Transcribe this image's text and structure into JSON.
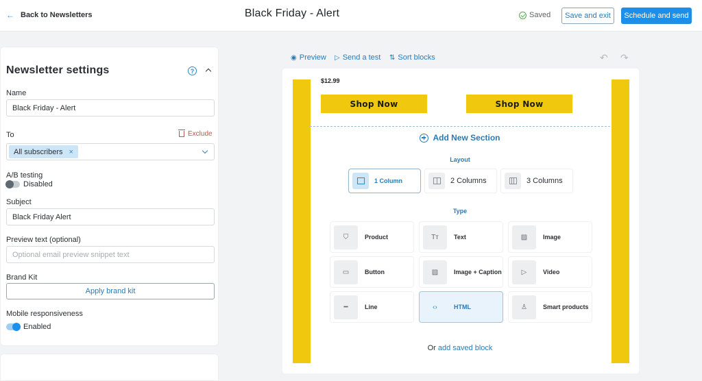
{
  "header": {
    "back_label": "Back to Newsletters",
    "title": "Black Friday - Alert",
    "saved_status": "Saved",
    "save_exit_label": "Save and exit",
    "schedule_label": "Schedule and send"
  },
  "settings": {
    "title": "Newsletter settings",
    "name": {
      "label": "Name",
      "value": "Black Friday - Alert"
    },
    "to": {
      "label": "To",
      "exclude_label": "Exclude",
      "chip": "All subscribers",
      "chip_remove": "×"
    },
    "ab_testing": {
      "label": "A/B testing",
      "state_label": "Disabled",
      "enabled": false
    },
    "subject": {
      "label": "Subject",
      "value": "Black Friday Alert"
    },
    "preview_text": {
      "label": "Preview text (optional)",
      "value": "",
      "placeholder": "Optional email preview snippet text"
    },
    "brand_kit": {
      "label": "Brand Kit",
      "button": "Apply brand kit"
    },
    "mobile": {
      "label": "Mobile responsiveness",
      "state_label": "Enabled",
      "enabled": true
    }
  },
  "editor_toolbar": {
    "preview": "Preview",
    "send_test": "Send a test",
    "sort_blocks": "Sort blocks",
    "undo_icon": "↶",
    "redo_icon": "↷"
  },
  "canvas": {
    "price": "$12.99",
    "shop_buttons": [
      "Shop Now",
      "Shop Now"
    ],
    "brand_color": "#f0c90e",
    "add_section": "Add New Section",
    "layout_label": "Layout",
    "layouts": [
      {
        "label": "1 Column",
        "cols": 1,
        "selected": true
      },
      {
        "label": "2 Columns",
        "cols": 2,
        "selected": false
      },
      {
        "label": "3 Columns",
        "cols": 3,
        "selected": false
      }
    ],
    "type_label": "Type",
    "types": [
      {
        "label": "Product",
        "icon": "shopping-bag-icon",
        "glyph": "⛉",
        "selected": false
      },
      {
        "label": "Text",
        "icon": "text-icon",
        "glyph": "Tт",
        "selected": false
      },
      {
        "label": "Image",
        "icon": "image-icon",
        "glyph": "▨",
        "selected": false
      },
      {
        "label": "Button",
        "icon": "button-icon",
        "glyph": "▭",
        "selected": false
      },
      {
        "label": "Image + Caption",
        "icon": "image-caption-icon",
        "glyph": "▨",
        "selected": false
      },
      {
        "label": "Video",
        "icon": "play-icon",
        "glyph": "▷",
        "selected": false
      },
      {
        "label": "Line",
        "icon": "line-icon",
        "glyph": "━",
        "selected": false
      },
      {
        "label": "HTML",
        "icon": "code-icon",
        "glyph": "‹›",
        "selected": true
      },
      {
        "label": "Smart products",
        "icon": "smart-products-icon",
        "glyph": "♙",
        "selected": false
      }
    ],
    "saved_block_prefix": "Or",
    "saved_block_link": "add saved block"
  }
}
